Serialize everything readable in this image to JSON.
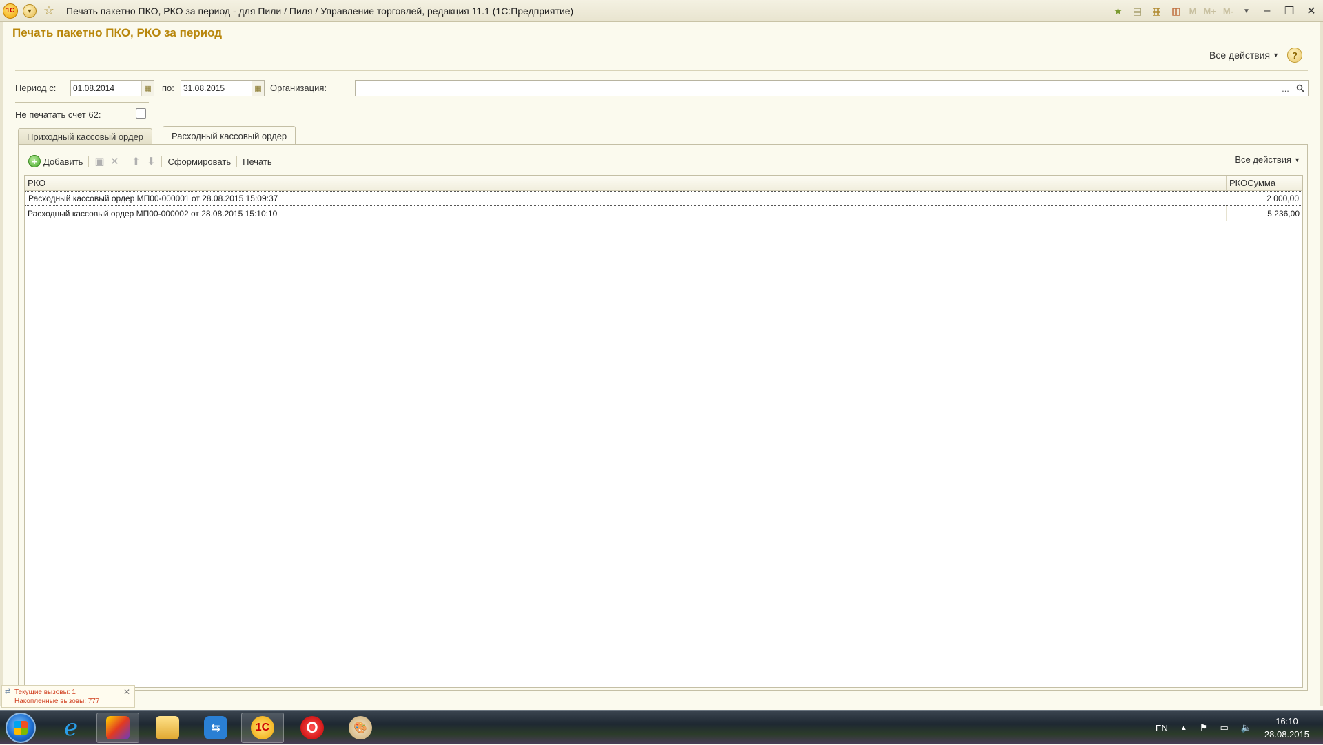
{
  "window": {
    "title": "Печать пакетно ПКО, РКО за период - для Пили / Пиля / Управление торговлей, редакция 11.1 (1С:Предприятие)",
    "logo_text": "1С",
    "toolbar_right": [
      "M",
      "M+",
      "M-"
    ]
  },
  "form": {
    "title": "Печать пакетно ПКО, РКО за период",
    "all_actions": "Все действия",
    "help": "?"
  },
  "filters": {
    "period_from_label": "Период с:",
    "period_from_value": "01.08.2014",
    "period_to_label": "по:",
    "period_to_value": "31.08.2015",
    "org_label": "Организация:",
    "org_value": "",
    "org_dots": "...",
    "no_print_label": "Не печатать счет 62:",
    "no_print_checked": false
  },
  "tabs": [
    {
      "label": "Приходный кассовый ордер",
      "active": false
    },
    {
      "label": "Расходный кассовый ордер",
      "active": true
    }
  ],
  "panel_toolbar": {
    "add": "Добавить",
    "form": "Сформировать",
    "print": "Печать",
    "all_actions": "Все действия"
  },
  "table": {
    "columns": [
      "РКО",
      "РКОСумма"
    ],
    "rows": [
      {
        "rko": "Расходный кассовый ордер МП00-000001 от 28.08.2015 15:09:37",
        "sum": "2 000,00"
      },
      {
        "rko": "Расходный кассовый ордер МП00-000002 от 28.08.2015 15:10:10",
        "sum": "5 236,00"
      }
    ]
  },
  "calls": {
    "current": "Текущие вызовы: 1",
    "accumulated": "Накопленные вызовы: 777"
  },
  "taskbar": {
    "lang": "EN",
    "time": "16:10",
    "date": "28.08.2015",
    "app_1c_label": "1С"
  }
}
